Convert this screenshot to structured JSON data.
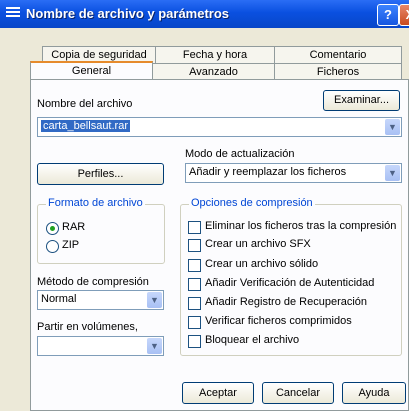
{
  "window": {
    "title": "Nombre de archivo y parámetros",
    "help_label": "?",
    "close_label": "X"
  },
  "tabs_back": [
    "Copia de seguridad",
    "Fecha y hora",
    "Comentario"
  ],
  "tabs_front": [
    "General",
    "Avanzado",
    "Ficheros"
  ],
  "active_tab": "General",
  "general": {
    "filename_label": "Nombre del archivo",
    "browse_label": "Examinar...",
    "filename_value": "carta_bellsaut.rar",
    "profiles_label": "Perfiles...",
    "update_mode_label": "Modo de actualización",
    "update_mode_value": "Añadir y reemplazar los ficheros",
    "format_label": "Formato de archivo",
    "format_options": [
      "RAR",
      "ZIP"
    ],
    "format_selected": "RAR",
    "compression_method_label": "Método de compresión",
    "compression_method_value": "Normal",
    "split_label": "Partir en volúmenes,",
    "split_value": "",
    "options_label": "Opciones de compresión",
    "options": [
      "Eliminar los ficheros tras la compresión",
      "Crear un archivo SFX",
      "Crear un archivo sólido",
      "Añadir Verificación de Autenticidad",
      "Añadir Registro de Recuperación",
      "Verificar ficheros comprimidos",
      "Bloquear el archivo"
    ]
  },
  "buttons": {
    "ok": "Aceptar",
    "cancel": "Cancelar",
    "help": "Ayuda"
  },
  "colors": {
    "title_bar": "#0A50E0",
    "dialog_bg": "#ECE9D8",
    "selection": "#316AC5",
    "group_legend": "#0046D5"
  }
}
